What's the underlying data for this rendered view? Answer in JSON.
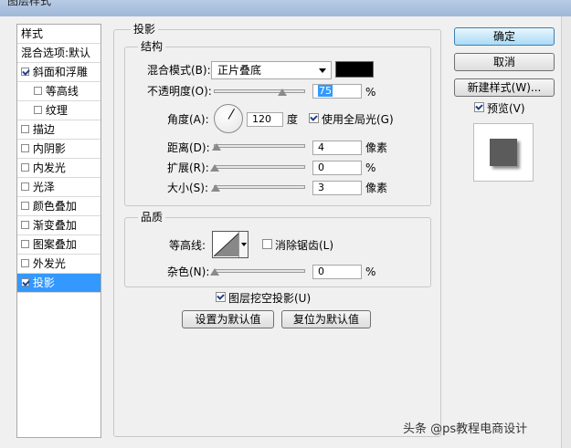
{
  "window": {
    "title": "图层样式"
  },
  "styles_list": [
    {
      "label": "样式",
      "checkbox": false,
      "checked": false,
      "indent": false,
      "selected": false
    },
    {
      "label": "混合选项:默认",
      "checkbox": false,
      "checked": false,
      "indent": false,
      "selected": false
    },
    {
      "label": "斜面和浮雕",
      "checkbox": true,
      "checked": true,
      "indent": false,
      "selected": false
    },
    {
      "label": "等高线",
      "checkbox": true,
      "checked": false,
      "indent": true,
      "selected": false
    },
    {
      "label": "纹理",
      "checkbox": true,
      "checked": false,
      "indent": true,
      "selected": false
    },
    {
      "label": "描边",
      "checkbox": true,
      "checked": false,
      "indent": false,
      "selected": false
    },
    {
      "label": "内阴影",
      "checkbox": true,
      "checked": false,
      "indent": false,
      "selected": false
    },
    {
      "label": "内发光",
      "checkbox": true,
      "checked": false,
      "indent": false,
      "selected": false
    },
    {
      "label": "光泽",
      "checkbox": true,
      "checked": false,
      "indent": false,
      "selected": false
    },
    {
      "label": "颜色叠加",
      "checkbox": true,
      "checked": false,
      "indent": false,
      "selected": false
    },
    {
      "label": "渐变叠加",
      "checkbox": true,
      "checked": false,
      "indent": false,
      "selected": false
    },
    {
      "label": "图案叠加",
      "checkbox": true,
      "checked": false,
      "indent": false,
      "selected": false
    },
    {
      "label": "外发光",
      "checkbox": true,
      "checked": false,
      "indent": false,
      "selected": false
    },
    {
      "label": "投影",
      "checkbox": true,
      "checked": true,
      "indent": false,
      "selected": true
    }
  ],
  "panel": {
    "title": "投影",
    "structure": {
      "title": "结构",
      "blend_mode_label": "混合模式(B):",
      "blend_mode_value": "正片叠底",
      "blend_color": "#000000",
      "opacity_label": "不透明度(O):",
      "opacity_value": "75",
      "opacity_unit": "%",
      "opacity_level": 0.75,
      "angle_label": "角度(A):",
      "angle_value": "120",
      "angle_unit": "度",
      "global_light_label": "使用全局光(G)",
      "global_light_checked": true,
      "distance_label": "距离(D):",
      "distance_value": "4",
      "distance_unit": "像素",
      "spread_label": "扩展(R):",
      "spread_value": "0",
      "spread_unit": "%",
      "size_label": "大小(S):",
      "size_value": "3",
      "size_unit": "像素"
    },
    "quality": {
      "title": "品质",
      "contour_label": "等高线:",
      "antialias_label": "消除锯齿(L)",
      "antialias_checked": false,
      "noise_label": "杂色(N):",
      "noise_value": "0",
      "noise_unit": "%"
    },
    "knockout_label": "图层挖空投影(U)",
    "knockout_checked": true,
    "set_default_label": "设置为默认值",
    "reset_default_label": "复位为默认值"
  },
  "buttons": {
    "ok": "确定",
    "cancel": "取消",
    "new_style": "新建样式(W)...",
    "preview_label": "预览(V)",
    "preview_checked": true
  },
  "watermark": "头条 @ps教程电商设计"
}
